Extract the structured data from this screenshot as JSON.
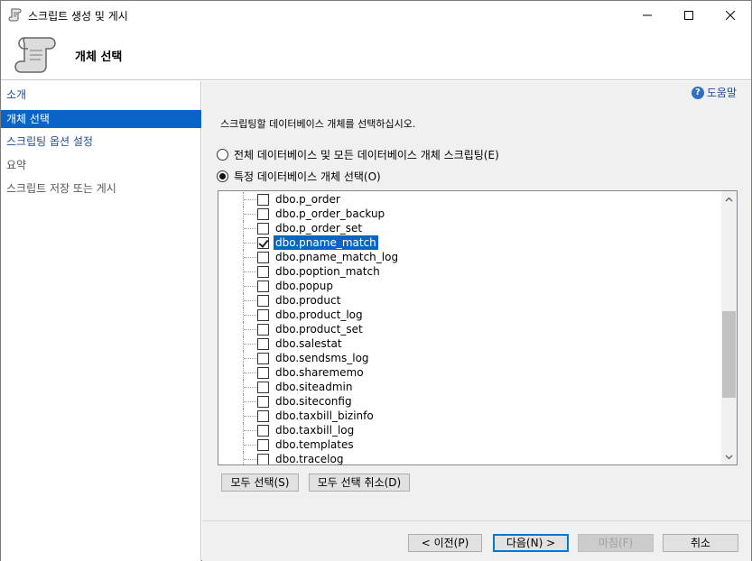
{
  "window": {
    "title": "스크립트 생성 및 게시",
    "icon": "script-scroll-icon",
    "controls": [
      "minimize-icon",
      "maximize-icon",
      "close-icon"
    ]
  },
  "header": {
    "title": "개체 선택",
    "icon": "script-scroll-icon"
  },
  "sidebar": {
    "items": [
      {
        "label": "소개",
        "state": "link"
      },
      {
        "label": "개체 선택",
        "state": "selected"
      },
      {
        "label": "스크립팅 옵션 설정",
        "state": "link"
      },
      {
        "label": "요약",
        "state": "disabled"
      },
      {
        "label": "스크립트 저장 또는 게시",
        "state": "disabled"
      }
    ]
  },
  "main": {
    "help_label": "도움말",
    "instruction": "스크립팅할 데이터베이스 개체를 선택하십시오.",
    "radio_all": "전체 데이터베이스 및 모든 데이터베이스 개체 스크립팅(E)",
    "radio_specific": "특정 데이터베이스 개체 선택(O)",
    "selected_radio": "specific",
    "tree_items": [
      {
        "label": "dbo.p_order",
        "checked": false,
        "selected": false
      },
      {
        "label": "dbo.p_order_backup",
        "checked": false,
        "selected": false
      },
      {
        "label": "dbo.p_order_set",
        "checked": false,
        "selected": false
      },
      {
        "label": "dbo.pname_match",
        "checked": true,
        "selected": true
      },
      {
        "label": "dbo.pname_match_log",
        "checked": false,
        "selected": false
      },
      {
        "label": "dbo.poption_match",
        "checked": false,
        "selected": false
      },
      {
        "label": "dbo.popup",
        "checked": false,
        "selected": false
      },
      {
        "label": "dbo.product",
        "checked": false,
        "selected": false
      },
      {
        "label": "dbo.product_log",
        "checked": false,
        "selected": false
      },
      {
        "label": "dbo.product_set",
        "checked": false,
        "selected": false
      },
      {
        "label": "dbo.salestat",
        "checked": false,
        "selected": false
      },
      {
        "label": "dbo.sendsms_log",
        "checked": false,
        "selected": false
      },
      {
        "label": "dbo.sharememo",
        "checked": false,
        "selected": false
      },
      {
        "label": "dbo.siteadmin",
        "checked": false,
        "selected": false
      },
      {
        "label": "dbo.siteconfig",
        "checked": false,
        "selected": false
      },
      {
        "label": "dbo.taxbill_bizinfo",
        "checked": false,
        "selected": false
      },
      {
        "label": "dbo.taxbill_log",
        "checked": false,
        "selected": false
      },
      {
        "label": "dbo.templates",
        "checked": false,
        "selected": false
      },
      {
        "label": "dbo.tracelog",
        "checked": false,
        "selected": false
      }
    ],
    "select_all": "모두 선택(S)",
    "deselect_all": "모두 선택 취소(D)"
  },
  "footer": {
    "prev": "< 이전(P)",
    "next": "다음(N) >",
    "finish": "마침(F)",
    "cancel": "취소"
  },
  "colors": {
    "selection": "#0a64c8",
    "link": "#1f4b8f",
    "panel_bg": "#f0f0f0"
  }
}
